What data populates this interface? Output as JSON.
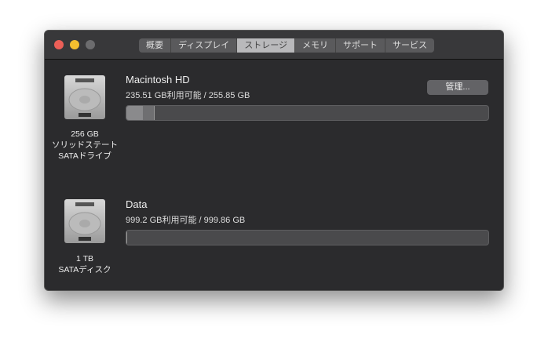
{
  "window": {
    "controls": [
      "close",
      "minimize",
      "zoom"
    ],
    "colors": {
      "close": "#ec5f57",
      "minimize": "#f5bf2f",
      "zoom": "#6c6c6e"
    }
  },
  "tabs": [
    {
      "label": "概要"
    },
    {
      "label": "ディスプレイ"
    },
    {
      "label": "ストレージ",
      "selected": true
    },
    {
      "label": "メモリ"
    },
    {
      "label": "サポート"
    },
    {
      "label": "サービス"
    }
  ],
  "drives": [
    {
      "name": "Macintosh HD",
      "usage": "235.51 GB利用可能 / 255.85 GB",
      "capacity": "256 GB",
      "type_line1": "ソリッドステート",
      "type_line2": "SATAドライブ",
      "manage_label": "管理...",
      "used_fractions": [
        0.045,
        0.033
      ]
    },
    {
      "name": "Data",
      "usage": "999.2 GB利用可能 / 999.86 GB",
      "capacity": "1 TB",
      "type_line1": "SATAディスク",
      "used_fractions": [
        0.001
      ]
    }
  ]
}
